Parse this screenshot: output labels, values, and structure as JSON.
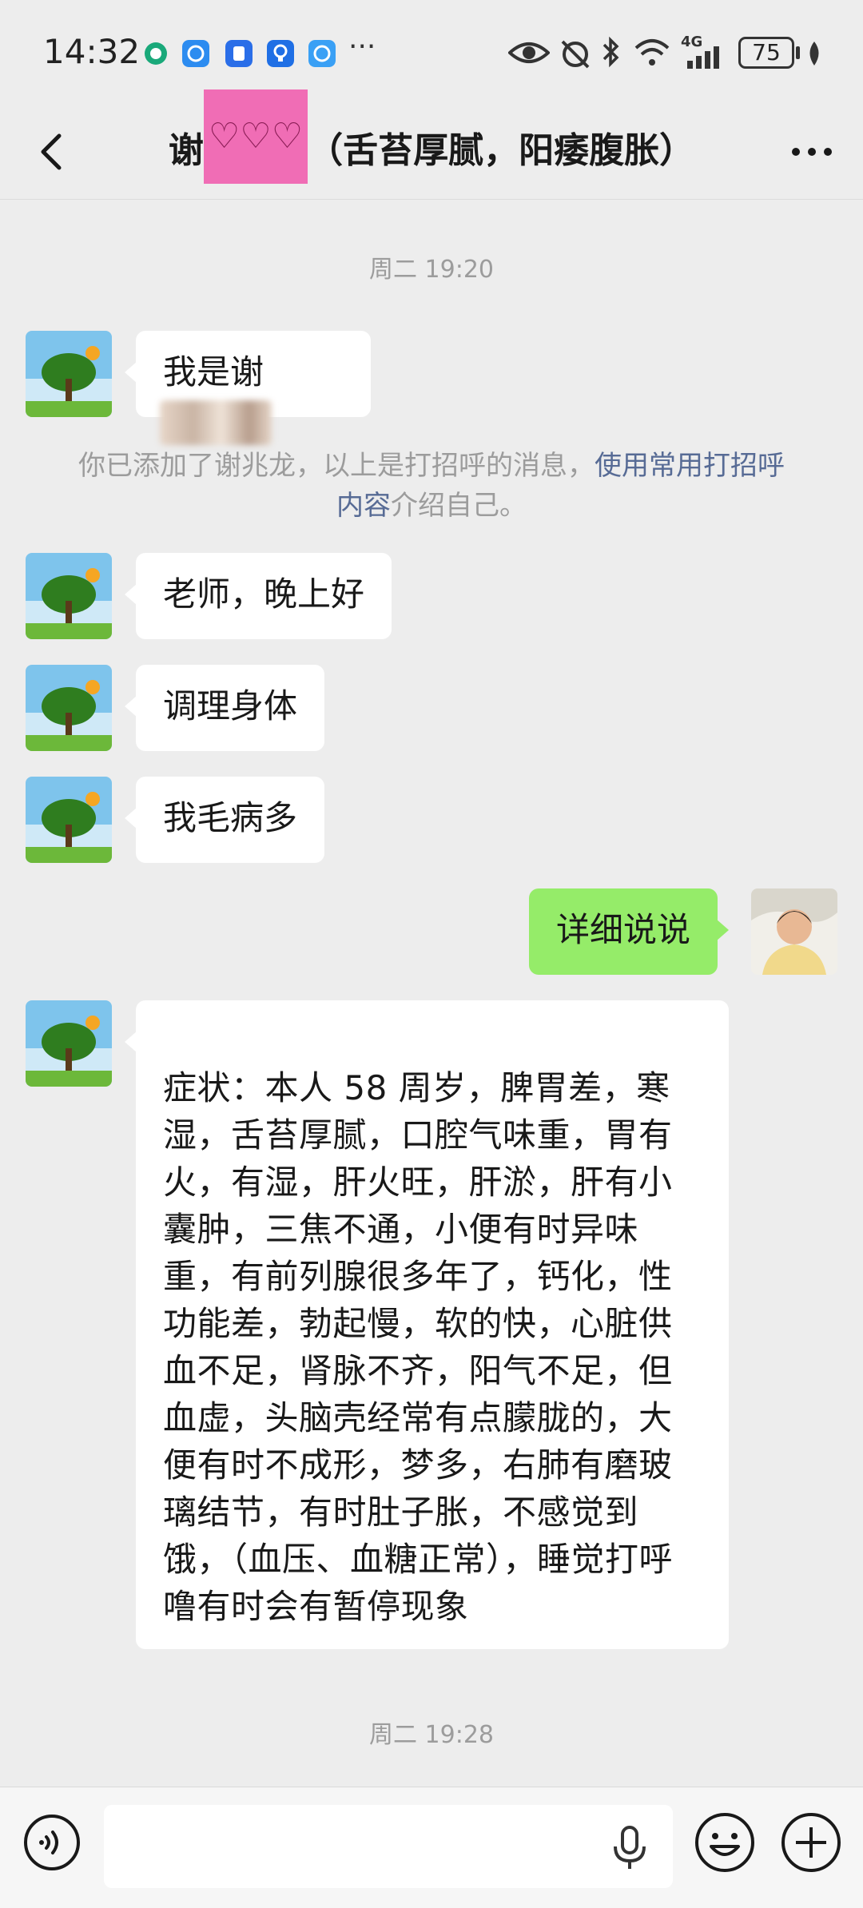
{
  "status_bar": {
    "time": "14:32",
    "battery": "75",
    "network": "4G"
  },
  "header": {
    "title_prefix": "谢",
    "title_highlight": "♡♡♡",
    "title_suffix": "（舌苔厚腻，阳痿腹胀）"
  },
  "messages": {
    "timestamp1": "周二 19:20",
    "greeting_text": "我是谢",
    "system_notice_prefix": "你已添加了谢兆龙，以上是打招呼的消息，",
    "system_notice_link": "使用常用打招呼内容",
    "system_notice_suffix": "介绍自己。",
    "msg1": "老师，晚上好",
    "msg2": "调理身体",
    "msg3": "我毛病多",
    "msg_me": "详细说说",
    "msg_long": "症状：本人 58 周岁，脾胃差，寒湿，舌苔厚腻，口腔气味重，胃有火，有湿，肝火旺，肝淤，肝有小囊肿，三焦不通，小便有时异味重，有前列腺很多年了，钙化，性功能差，勃起慢，软的快，心脏供血不足，肾脉不齐，阳气不足，但血虚，头脑壳经常有点朦胧的，大便有时不成形，梦多，右肺有磨玻璃结节，有时肚子胀，不感觉到饿，（血压、血糖正常），睡觉打呼噜有时会有暂停现象",
    "timestamp2": "周二 19:28"
  },
  "colors": {
    "background": "#ededed",
    "my_bubble": "#95ec69",
    "link": "#576b95",
    "highlight": "#f06db5"
  }
}
